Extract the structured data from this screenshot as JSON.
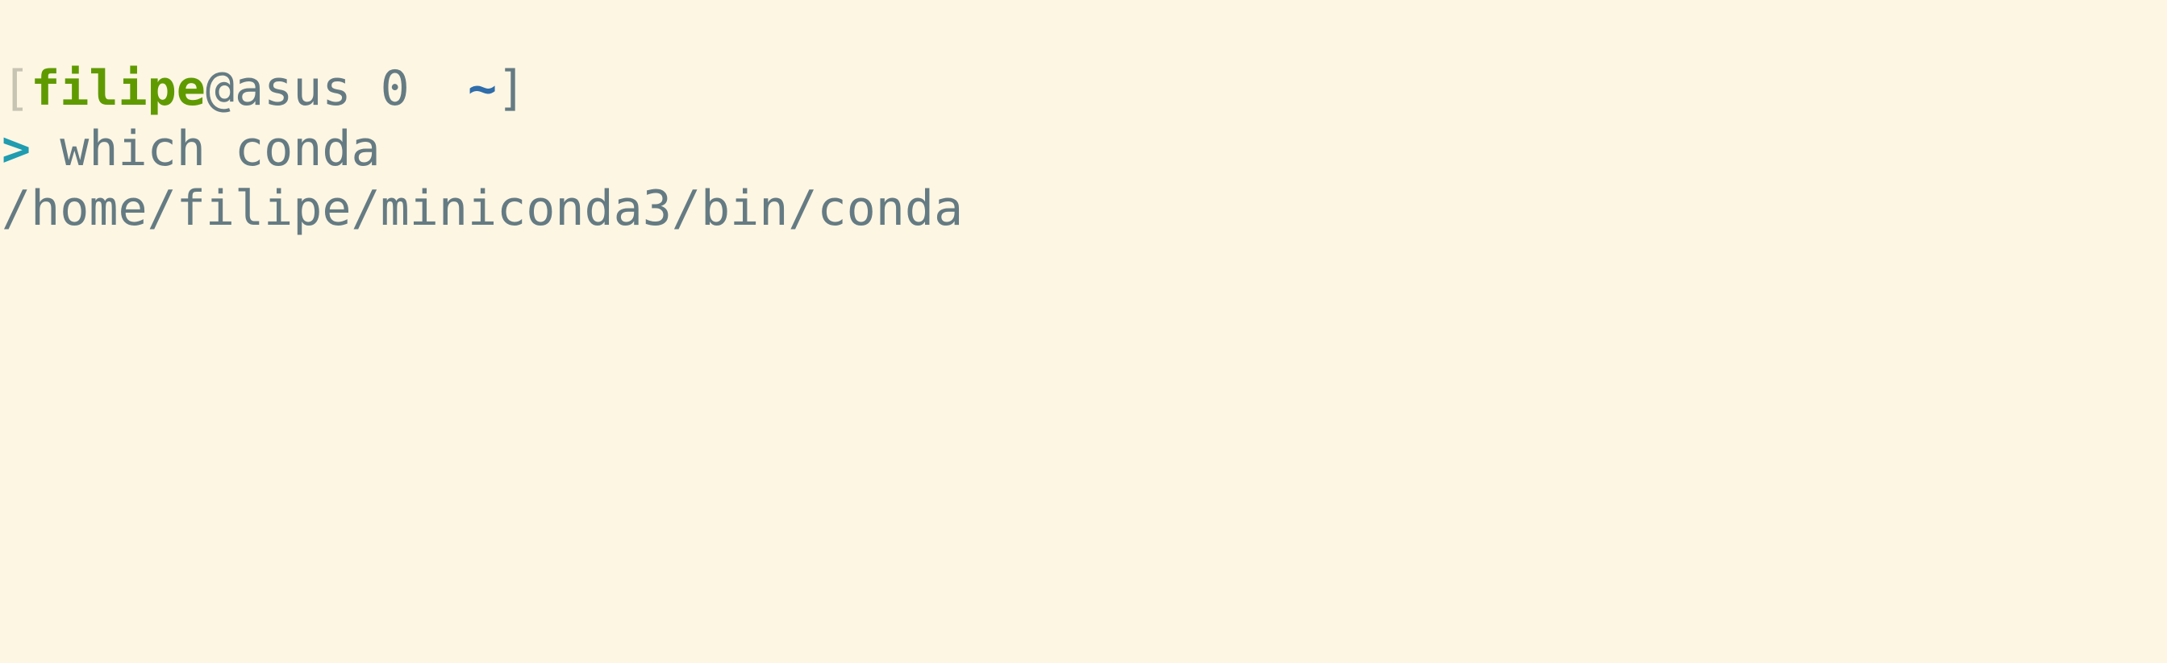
{
  "colors": {
    "background": "#fdf6e3",
    "text": "#657b83",
    "user": "#5f9a00",
    "cwd": "#2f6dab",
    "prompt_arrow": "#1f9cb0"
  },
  "prompt": {
    "open_bracket": "[",
    "user": "filipe",
    "at": "@",
    "host": "asus",
    "status": " 0  ",
    "cwd": "~",
    "close_bracket": "]"
  },
  "command_line": {
    "arrow": ">",
    "command": " which conda"
  },
  "output": {
    "text": "/home/filipe/miniconda3/bin/conda"
  }
}
